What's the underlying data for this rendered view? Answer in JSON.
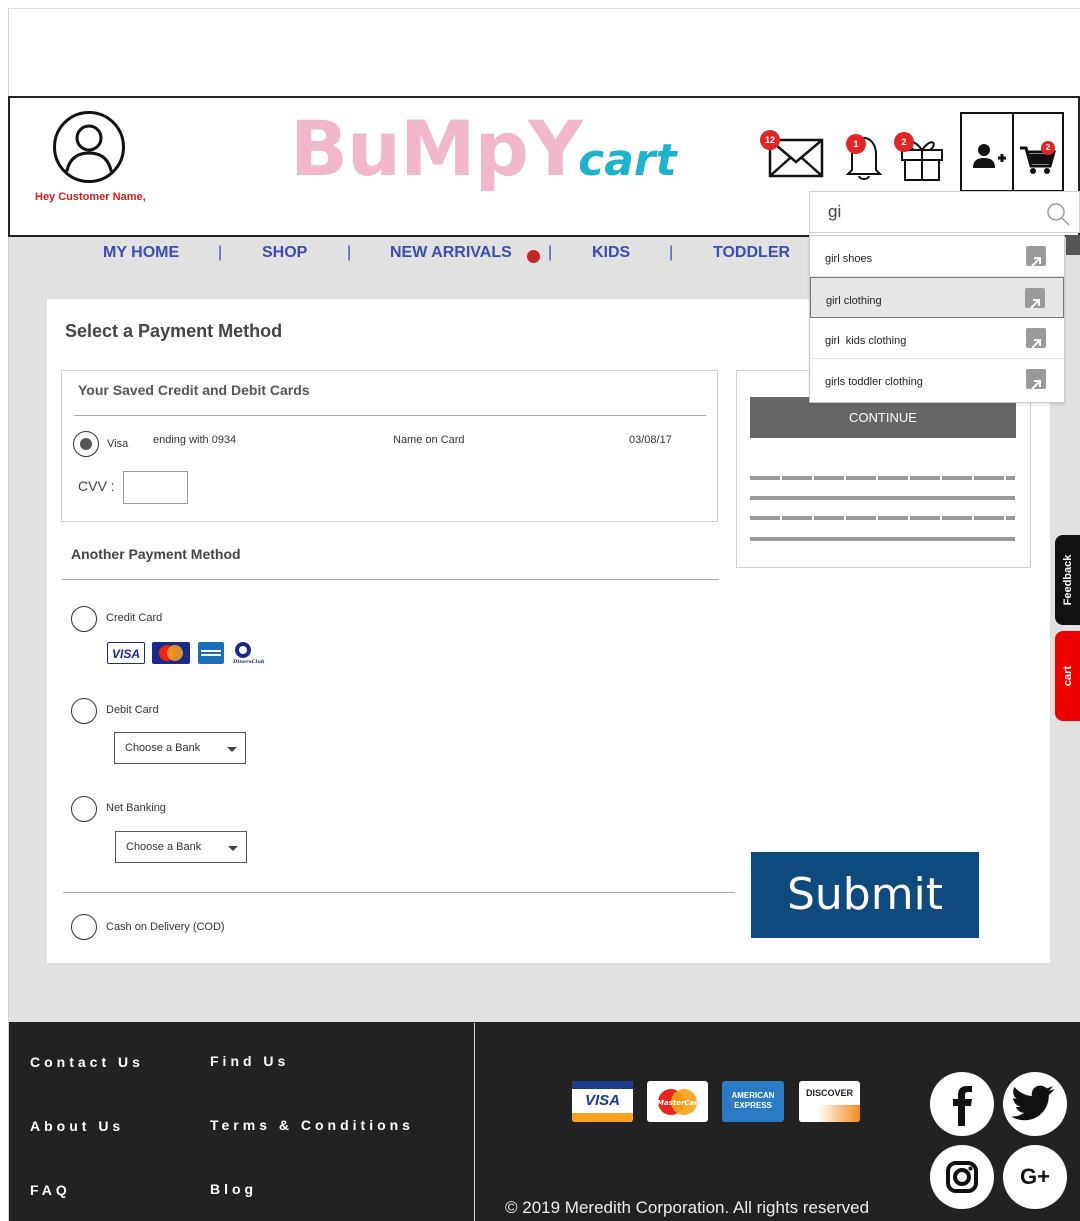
{
  "header": {
    "greeting": "Hey Customer Name,",
    "logo_main": "BuMpY",
    "logo_sub": "cart",
    "badges": {
      "mail": "12",
      "bell": "1",
      "gift": "2",
      "cart": "2"
    }
  },
  "search": {
    "value": "gi",
    "suggestions": [
      "girl shoes",
      "girl clothing",
      "girl  kids clothing",
      "girls toddler clothing"
    ]
  },
  "nav": {
    "items": [
      "MY HOME",
      "SHOP",
      "NEW ARRIVALS",
      "KIDS",
      "TODDLER"
    ],
    "separator": "|"
  },
  "payment": {
    "title": "Select a Payment Method",
    "saved_title": "Your Saved Credit and Debit Cards",
    "saved_card": {
      "brand": "Visa",
      "ending": "ending with 0934",
      "name": "Name on Card",
      "expiry": "03/08/17"
    },
    "cvv_label": "CVV :",
    "another_title": "Another Payment Method",
    "options": {
      "credit": "Credit Card",
      "debit": "Debit Card",
      "netbanking": "Net Banking",
      "cod": "Cash on Delivery (COD)"
    },
    "bank_placeholder": "Choose a Bank",
    "card_logos": [
      "VISA",
      "MasterCard",
      "AMEX",
      "Diners Club"
    ]
  },
  "summary": {
    "continue": "CONTINUE"
  },
  "submit_label": "Submit",
  "side_tabs": {
    "feedback": "Feedback",
    "cart": "cart"
  },
  "footer": {
    "col1": [
      "Contact Us",
      "About Us",
      "FAQ"
    ],
    "col2": [
      "Find Us",
      "Terms & Conditions",
      "Blog"
    ],
    "cards": [
      "VISA",
      "MasterCard",
      "AMERICAN EXPRESS",
      "DISCOVER"
    ],
    "copyright": "© 2019 Meredith Corporation. All rights reserved",
    "social": [
      "f",
      "twitter",
      "instagram",
      "G+"
    ]
  },
  "colors": {
    "logo_pink": "#f0b7cd",
    "logo_cyan": "#1eb2cc",
    "nav_blue": "#3a4db1",
    "submit_blue": "#0e4a7e",
    "badge_red": "#e02626"
  }
}
